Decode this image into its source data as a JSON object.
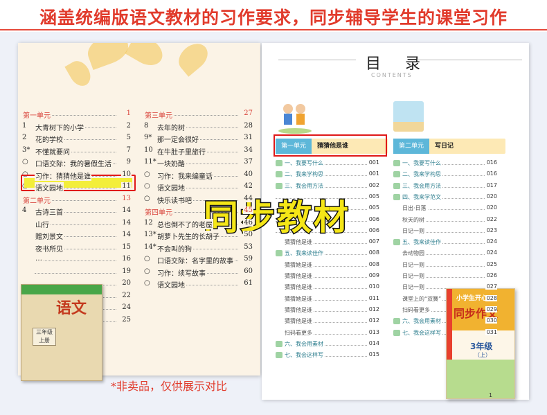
{
  "header": {
    "title": "涵盖统编版语文教材的习作要求，同步辅导学生的课堂习作"
  },
  "textbook": {
    "col1": [
      {
        "type": "unit",
        "txt": "第一单元",
        "pg": "1"
      },
      {
        "num": "1",
        "txt": "大青树下的小学",
        "pg": "2"
      },
      {
        "num": "2",
        "txt": "花的学校",
        "pg": "5"
      },
      {
        "num": "3*",
        "txt": "不懂就要问",
        "pg": "7"
      },
      {
        "num": "○",
        "txt": "口语交际：我的暑假生活",
        "pg": "9"
      },
      {
        "num": "○",
        "txt": "习作：猜猜他是谁",
        "pg": "10"
      },
      {
        "num": "○",
        "txt": "语文园地",
        "pg": "11"
      },
      {
        "type": "unit",
        "txt": "第二单元",
        "pg": "13"
      },
      {
        "num": "4",
        "txt": "古诗三首",
        "pg": "14"
      },
      {
        "num": "",
        "txt": "山行",
        "pg": "14"
      },
      {
        "num": "",
        "txt": "赠刘景文",
        "pg": "14"
      },
      {
        "num": "",
        "txt": "夜书所见",
        "pg": "15"
      },
      {
        "num": "",
        "txt": "…",
        "pg": "16"
      },
      {
        "num": "",
        "txt": "",
        "pg": "19"
      },
      {
        "num": "",
        "txt": "",
        "pg": "20"
      },
      {
        "num": "",
        "txt": "",
        "pg": "22"
      },
      {
        "num": "",
        "txt": "",
        "pg": "24"
      },
      {
        "num": "",
        "txt": "",
        "pg": "25"
      }
    ],
    "col2": [
      {
        "type": "unit",
        "txt": "第三单元",
        "pg": "27"
      },
      {
        "num": "8",
        "txt": "去年的树",
        "pg": "28"
      },
      {
        "num": "9*",
        "txt": "那一定会很好",
        "pg": "31"
      },
      {
        "num": "10",
        "txt": "在牛肚子里旅行",
        "pg": "34"
      },
      {
        "num": "11*",
        "txt": "一块奶酪",
        "pg": "37"
      },
      {
        "num": "○",
        "txt": "习作：我来编童话",
        "pg": "40"
      },
      {
        "num": "○",
        "txt": "语文园地",
        "pg": "42"
      },
      {
        "num": "○",
        "txt": "快乐读书吧",
        "pg": "44"
      },
      {
        "type": "unit",
        "txt": "第四单元",
        "pg": "45"
      },
      {
        "num": "12",
        "txt": "总也倒不了的老屋",
        "pg": "46"
      },
      {
        "num": "13*",
        "txt": "胡萝卜先生的长胡子",
        "pg": "50"
      },
      {
        "num": "14*",
        "txt": "不会叫的狗",
        "pg": "53"
      },
      {
        "num": "○",
        "txt": "口语交际：名字里的故事",
        "pg": "59"
      },
      {
        "num": "○",
        "txt": "习作：续写故事",
        "pg": "60"
      },
      {
        "num": "○",
        "txt": "语文园地",
        "pg": "61"
      }
    ],
    "cover": {
      "title": "语文",
      "grade": "三年级\n上册"
    }
  },
  "watermark": "同步教材",
  "note": "*非卖品，仅供展示对比",
  "workbook": {
    "title": "目 录",
    "subtitle": "CONTENTS",
    "unit1": {
      "tag": "第一单元",
      "name": "猜猜他是谁"
    },
    "unit2": {
      "tag": "第二单元",
      "name": "写日记"
    },
    "col1": [
      {
        "k": "sec",
        "lbl": "一、我要写什么",
        "pg": "001"
      },
      {
        "k": "sec",
        "lbl": "二、我来学构思",
        "pg": "001"
      },
      {
        "k": "sec",
        "lbl": "三、我会用方法",
        "pg": "002"
      },
      {
        "k": "sub",
        "lbl": "",
        "pg": "005"
      },
      {
        "k": "sub",
        "lbl": "",
        "pg": "005"
      },
      {
        "k": "sub",
        "lbl": "",
        "pg": "006"
      },
      {
        "k": "sub",
        "lbl": "",
        "pg": "006"
      },
      {
        "k": "sub",
        "lbl": "猜猜他是谁",
        "pg": "007"
      },
      {
        "k": "sec",
        "lbl": "五、我来读佳作",
        "pg": "008"
      },
      {
        "k": "sub",
        "lbl": "猜猜她是谁",
        "pg": "008"
      },
      {
        "k": "sub",
        "lbl": "猜猜他是谁",
        "pg": "009"
      },
      {
        "k": "sub",
        "lbl": "猜猜他是谁",
        "pg": "010"
      },
      {
        "k": "sub",
        "lbl": "猜猜她是谁",
        "pg": "011"
      },
      {
        "k": "sub",
        "lbl": "猜猜他是谁",
        "pg": "012"
      },
      {
        "k": "sub",
        "lbl": "猜猜他是谁",
        "pg": "012"
      },
      {
        "k": "sub",
        "lbl": "扫码看更多",
        "pg": "013"
      },
      {
        "k": "sec",
        "lbl": "六、我会用素材",
        "pg": "014"
      },
      {
        "k": "sec",
        "lbl": "七、我会这样写",
        "pg": "015"
      }
    ],
    "col2": [
      {
        "k": "sec",
        "lbl": "一、我要写什么",
        "pg": "016"
      },
      {
        "k": "sec",
        "lbl": "二、我来学构思",
        "pg": "016"
      },
      {
        "k": "sec",
        "lbl": "三、我会用方法",
        "pg": "017"
      },
      {
        "k": "sec",
        "lbl": "四、我来学范文",
        "pg": "020"
      },
      {
        "k": "sub",
        "lbl": "日出·日落",
        "pg": "020"
      },
      {
        "k": "sub",
        "lbl": "秋天的树",
        "pg": "022"
      },
      {
        "k": "sub",
        "lbl": "日记一则",
        "pg": "023"
      },
      {
        "k": "sec",
        "lbl": "五、我来读佳作",
        "pg": "024"
      },
      {
        "k": "sub",
        "lbl": "去动物园",
        "pg": "024"
      },
      {
        "k": "sub",
        "lbl": "日记一则",
        "pg": "025"
      },
      {
        "k": "sub",
        "lbl": "日记一则",
        "pg": "026"
      },
      {
        "k": "sub",
        "lbl": "日记一则",
        "pg": "027"
      },
      {
        "k": "sub",
        "lbl": "课堂上的“双簧”",
        "pg": "028"
      },
      {
        "k": "sub",
        "lbl": "扫码看更多",
        "pg": "029"
      },
      {
        "k": "sec",
        "lbl": "六、我会用素材",
        "pg": "030"
      },
      {
        "k": "sec",
        "lbl": "七、我会这样写",
        "pg": "031"
      }
    ],
    "cover": {
      "series": "小学生开心",
      "title": "同步作文",
      "grade": "3年级",
      "vol": "（上）"
    },
    "page": "1"
  }
}
